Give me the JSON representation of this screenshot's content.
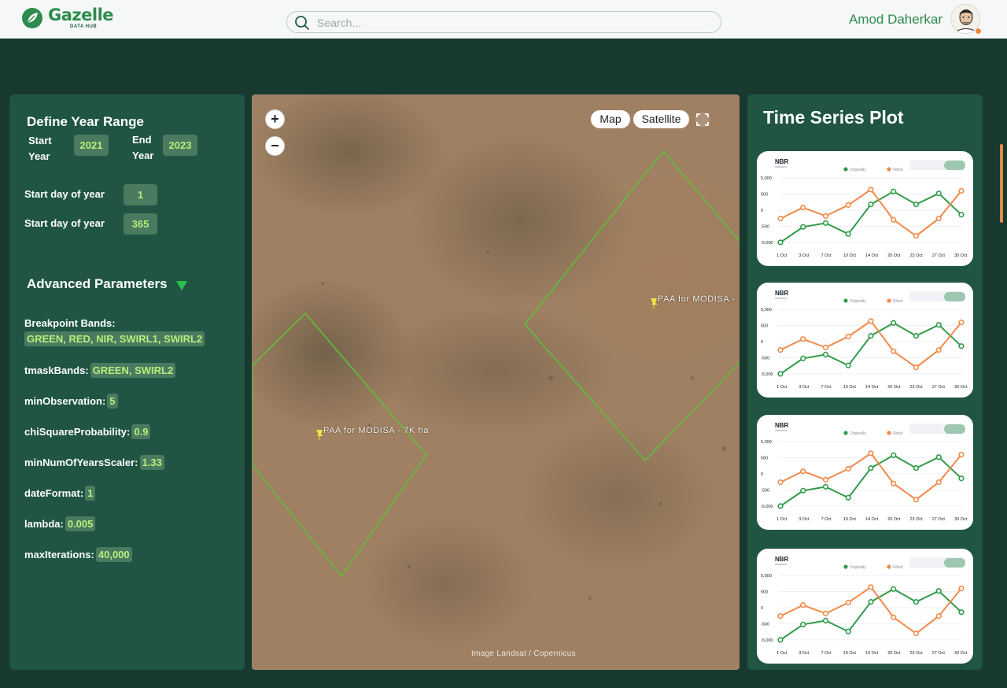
{
  "header": {
    "brand": "Gazelle",
    "brand_sub": "DATA HUB",
    "search_placeholder": "Search...",
    "user_name": "Amod Daherkar"
  },
  "left_panel": {
    "title": "Define Year Range",
    "start_year_label": [
      "Start",
      "Year"
    ],
    "start_year": "2021",
    "end_year_label": [
      "End",
      "Year"
    ],
    "end_year": "2023",
    "start_doy_label": "Start day of year",
    "start_doy": "1",
    "end_doy_label": "Start day of year",
    "end_doy": "365",
    "advanced_title": "Advanced Parameters",
    "params": [
      {
        "label": "Breakpoint Bands:",
        "value": "GREEN, RED, NIR, SWIRL1, SWIRL2"
      },
      {
        "label": "tmaskBands:",
        "value": "GREEN, SWIRL2"
      },
      {
        "label": "minObservation:",
        "value": "5"
      },
      {
        "label": "chiSquareProbability:",
        "value": "0.9"
      },
      {
        "label": "minNumOfYearsScaler:",
        "value": "1.33"
      },
      {
        "label": "dateFormat:",
        "value": "1"
      },
      {
        "label": "lambda:",
        "value": "0.005"
      },
      {
        "label": "maxIterations:",
        "value": "40,000"
      }
    ]
  },
  "map": {
    "zoom_in": "+",
    "zoom_out": "−",
    "map_btn": "Map",
    "satellite_btn": "Satellite",
    "label_right": "PAA for MODISA -",
    "label_left": "PAA for MODISA - 7K ha",
    "attribution": "Image Landsat / Copernicus"
  },
  "right_panel": {
    "title": "Time Series Plot"
  },
  "chart_data": [
    {
      "type": "line",
      "title": "NBR",
      "subtitle": "statistics",
      "legend_position": "top-center",
      "categories": [
        "1 Oct",
        "3 Oct",
        "7 Oct",
        "10 Oct",
        "14 Oct",
        "20 Oct",
        "23 Oct",
        "27 Oct",
        "30 Oct"
      ],
      "x_positions": [
        0,
        2,
        3.5,
        5,
        7.5,
        9.5,
        11,
        12.5,
        14.5,
        15.5
      ],
      "series": [
        {
          "name": "Originally",
          "color": "#2f9b49",
          "values": [
            -5000,
            -2600,
            -2000,
            -3700,
            900,
            2900,
            900,
            2600,
            -700
          ]
        },
        {
          "name": "Fitted",
          "color": "#f28a4a",
          "values": [
            -1300,
            400,
            -900,
            800,
            3200,
            -1500,
            -4000,
            -1300,
            3000
          ]
        }
      ],
      "y_ticks": [
        "5,000",
        "500",
        "0",
        "-500",
        "-5,000"
      ],
      "ylim": [
        -5500,
        5500
      ],
      "grid": true
    },
    {
      "type": "line",
      "title": "NBR",
      "subtitle": "statistics",
      "legend_position": "top-center",
      "categories": [
        "1 Oct",
        "3 Oct",
        "7 Oct",
        "10 Oct",
        "14 Oct",
        "20 Oct",
        "23 Oct",
        "27 Oct",
        "30 Oct"
      ],
      "series": [
        {
          "name": "Originally",
          "color": "#2f9b49",
          "values": [
            -5000,
            -2600,
            -2000,
            -3700,
            900,
            2900,
            900,
            2600,
            -700
          ]
        },
        {
          "name": "Fitted",
          "color": "#f28a4a",
          "values": [
            -1300,
            400,
            -900,
            800,
            3200,
            -1500,
            -4000,
            -1300,
            3000
          ]
        }
      ],
      "y_ticks": [
        "5,000",
        "500",
        "0",
        "-500",
        "-5,000"
      ],
      "ylim": [
        -5500,
        5500
      ],
      "grid": true
    },
    {
      "type": "line",
      "title": "NBR",
      "subtitle": "statistics",
      "legend_position": "top-center",
      "categories": [
        "1 Oct",
        "3 Oct",
        "7 Oct",
        "10 Oct",
        "14 Oct",
        "20 Oct",
        "23 Oct",
        "27 Oct",
        "30 Oct"
      ],
      "series": [
        {
          "name": "Originally",
          "color": "#2f9b49",
          "values": [
            -5000,
            -2600,
            -2000,
            -3700,
            900,
            2900,
            900,
            2600,
            -700
          ]
        },
        {
          "name": "Fitted",
          "color": "#f28a4a",
          "values": [
            -1300,
            400,
            -900,
            800,
            3200,
            -1500,
            -4000,
            -1300,
            3000
          ]
        }
      ],
      "y_ticks": [
        "5,000",
        "500",
        "0",
        "-500",
        "-5,000"
      ],
      "ylim": [
        -5500,
        5500
      ],
      "grid": true
    },
    {
      "type": "line",
      "title": "NBR",
      "subtitle": "statistics",
      "legend_position": "top-center",
      "categories": [
        "1 Oct",
        "3 Oct",
        "7 Oct",
        "10 Oct",
        "14 Oct",
        "20 Oct",
        "23 Oct",
        "27 Oct",
        "30 Oct"
      ],
      "series": [
        {
          "name": "Originally",
          "color": "#2f9b49",
          "values": [
            -5000,
            -2600,
            -2000,
            -3700,
            900,
            2900,
            900,
            2600,
            -700
          ]
        },
        {
          "name": "Fitted",
          "color": "#f28a4a",
          "values": [
            -1300,
            400,
            -900,
            800,
            3200,
            -1500,
            -4000,
            -1300,
            3000
          ]
        }
      ],
      "y_ticks": [
        "5,000",
        "500",
        "0",
        "-500",
        "-5,000"
      ],
      "ylim": [
        -5500,
        5500
      ],
      "grid": true
    }
  ],
  "colors": {
    "accent": "#2e8b4e",
    "panel": "#1f5542",
    "background": "#17392f",
    "pill": "#4a7a60",
    "pill_text": "#b6ef7a"
  }
}
